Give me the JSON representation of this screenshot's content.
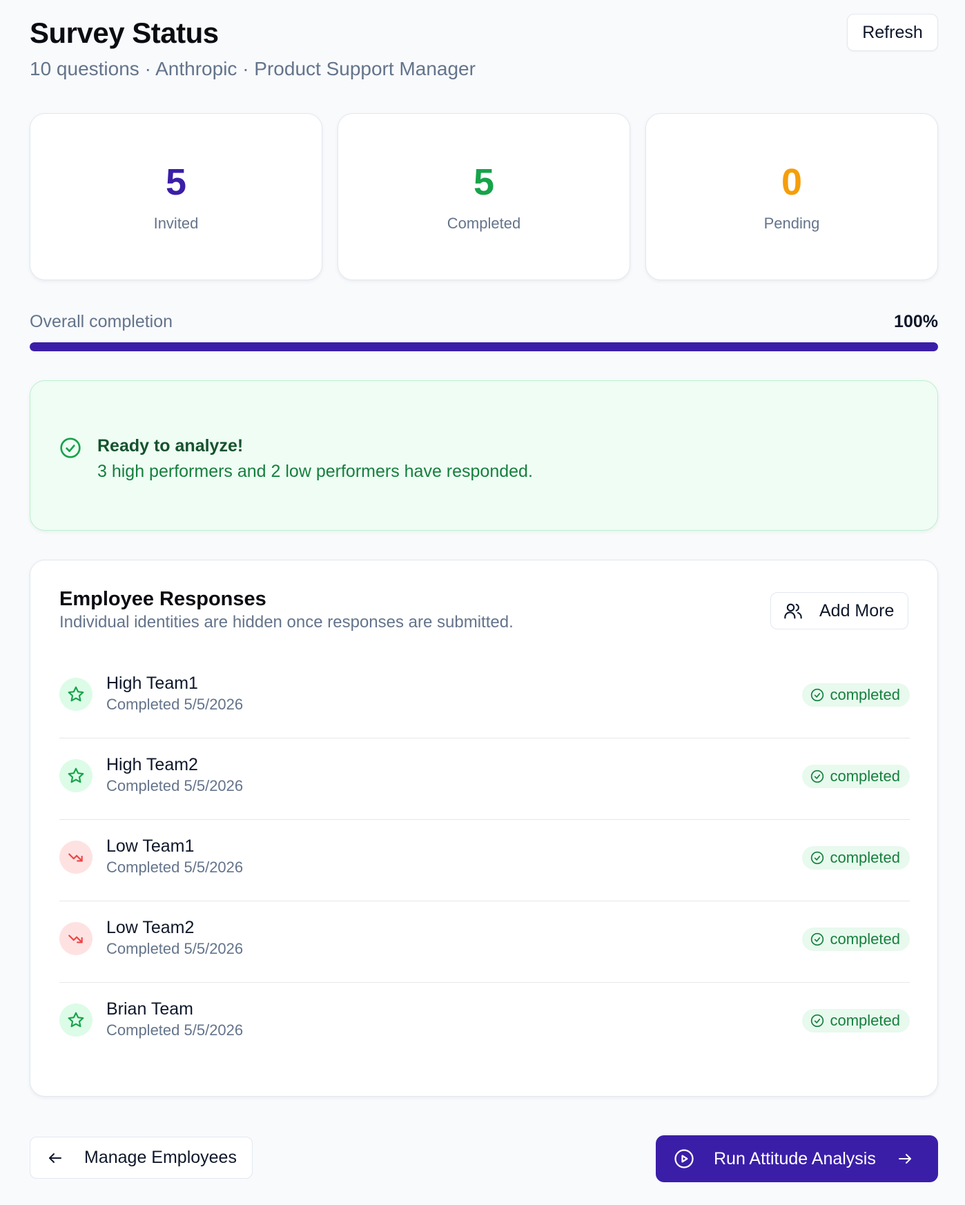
{
  "header": {
    "title": "Survey Status",
    "subtitle": "10 questions · Anthropic · Product Support Manager",
    "refresh_label": "Refresh"
  },
  "stats": [
    {
      "value": "5",
      "label": "Invited",
      "color": "#3b1ea8"
    },
    {
      "value": "5",
      "label": "Completed",
      "color": "#16a34a"
    },
    {
      "value": "0",
      "label": "Pending",
      "color": "#f59e0b"
    }
  ],
  "progress": {
    "label": "Overall completion",
    "percent_text": "100%",
    "fraction": 1.0,
    "color": "#3b1ea8"
  },
  "ready": {
    "icon": "check-circle-icon",
    "title": "Ready to analyze!",
    "text": "3 high performers and 2 low performers have responded."
  },
  "responses": {
    "title": "Employee Responses",
    "subtitle": "Individual identities are hidden once responses are submitted.",
    "add_label": "Add More",
    "rows": [
      {
        "name": "High Team1",
        "date": "Completed 5/5/2026",
        "kind": "high",
        "icon": "star-icon",
        "status": "completed"
      },
      {
        "name": "High Team2",
        "date": "Completed 5/5/2026",
        "kind": "high",
        "icon": "star-icon",
        "status": "completed"
      },
      {
        "name": "Low Team1",
        "date": "Completed 5/5/2026",
        "kind": "low",
        "icon": "trending-down-icon",
        "status": "completed"
      },
      {
        "name": "Low Team2",
        "date": "Completed 5/5/2026",
        "kind": "low",
        "icon": "trending-down-icon",
        "status": "completed"
      },
      {
        "name": "Brian Team",
        "date": "Completed 5/5/2026",
        "kind": "high",
        "icon": "star-icon",
        "status": "completed"
      }
    ]
  },
  "footer": {
    "manage_label": "Manage Employees",
    "run_label": "Run Attitude Analysis"
  }
}
